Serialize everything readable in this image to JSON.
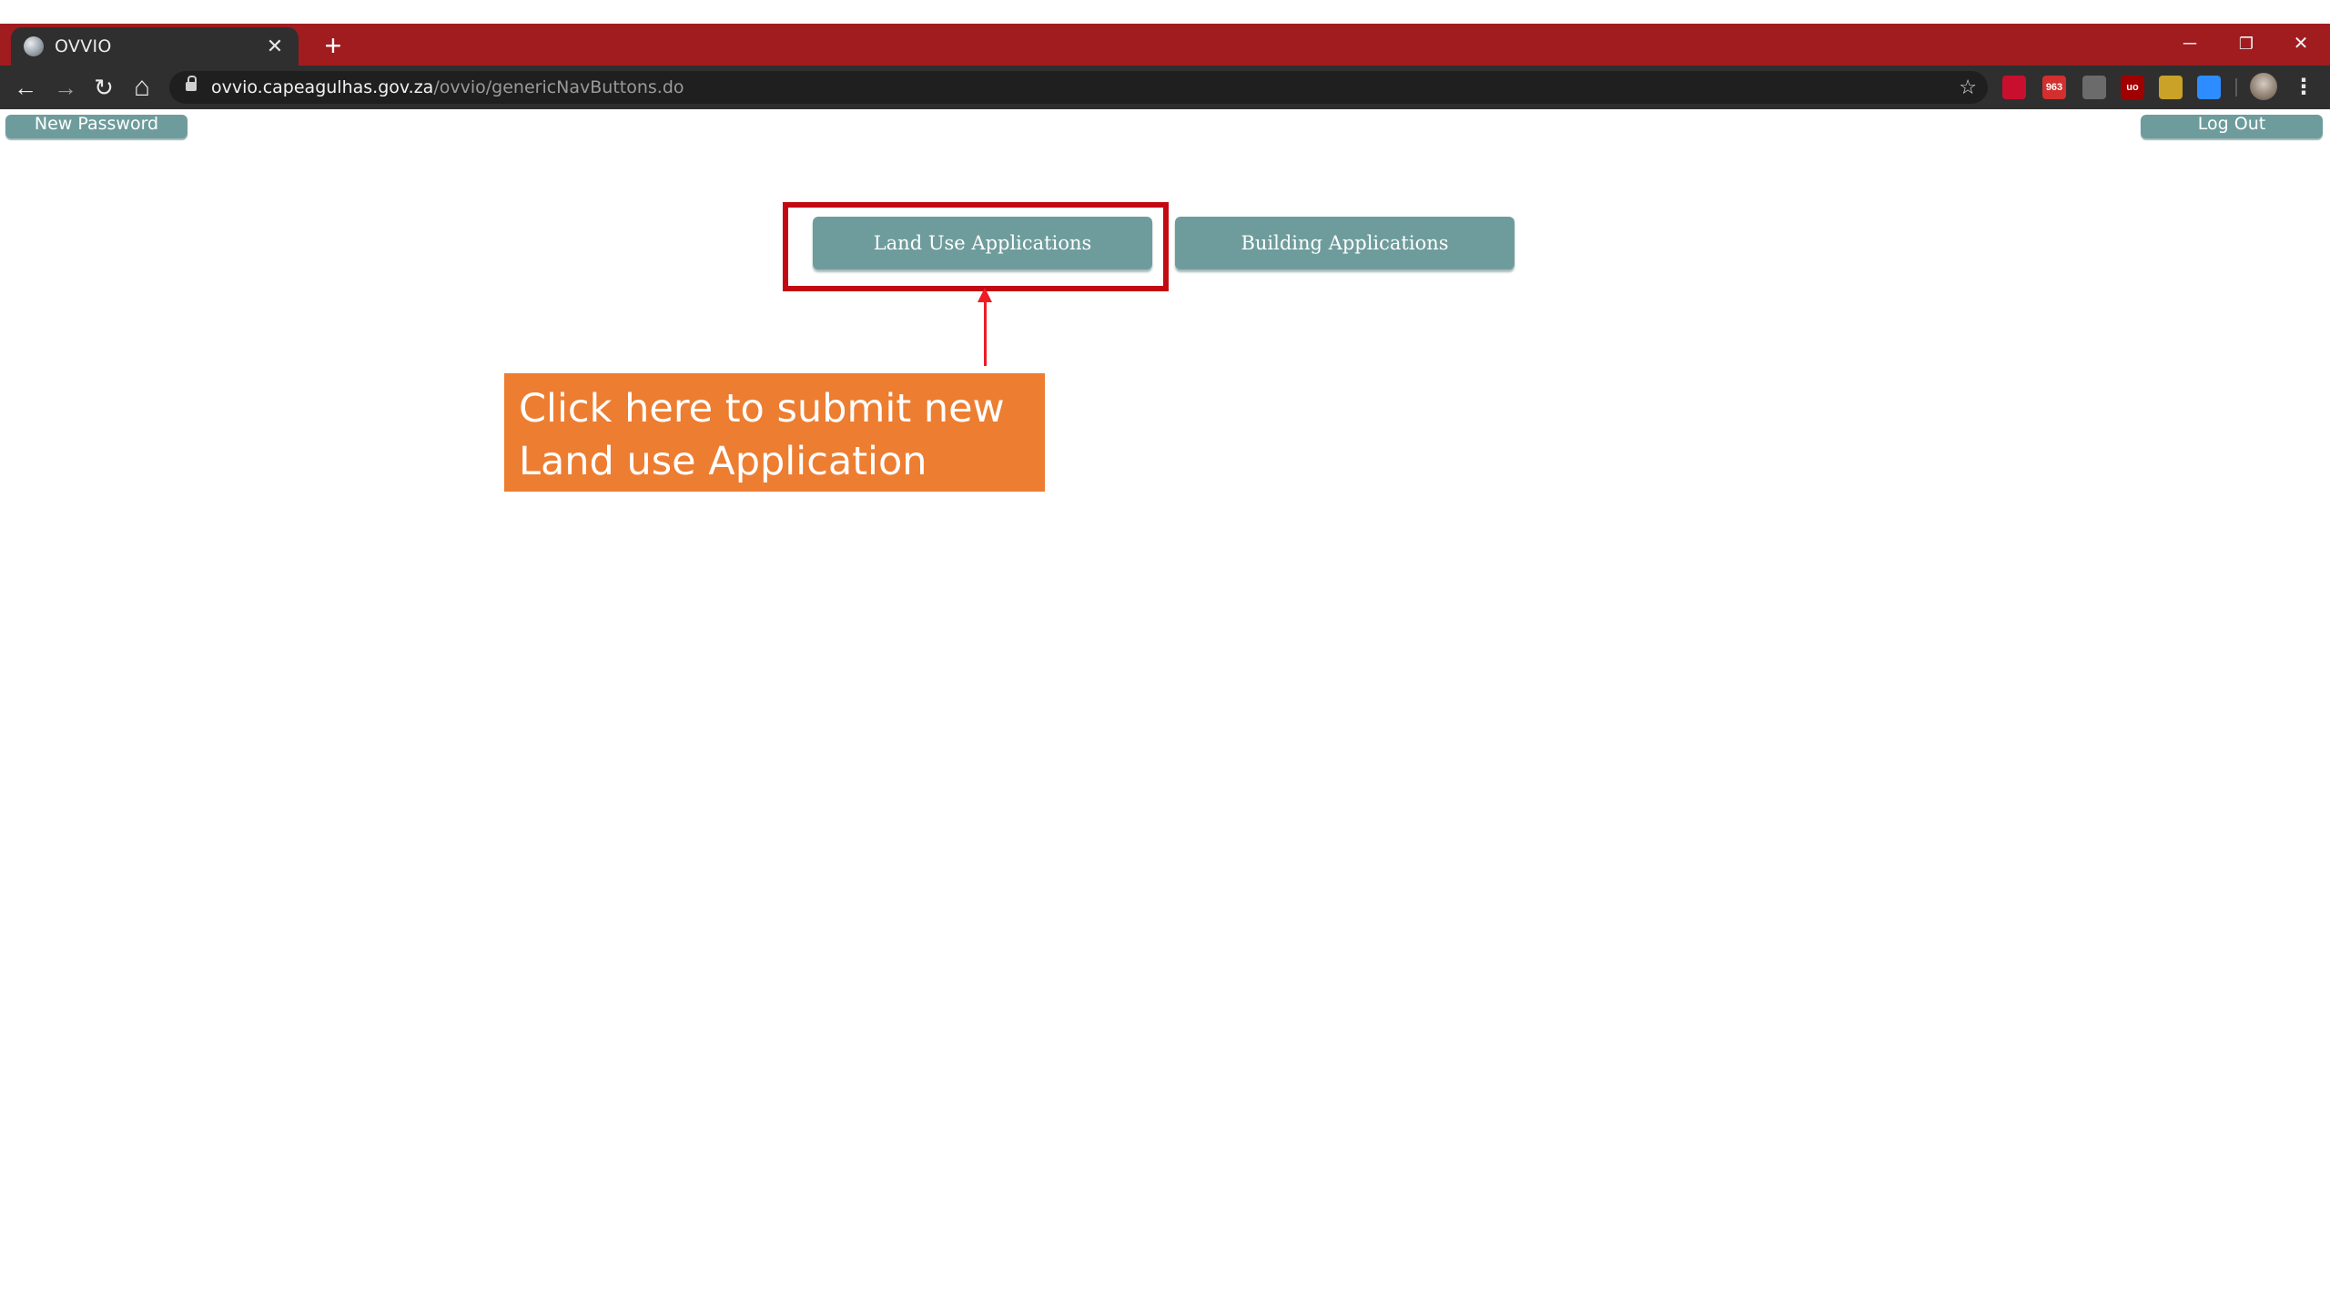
{
  "browser": {
    "tab": {
      "title": "OVVIO",
      "close_glyph": "✕",
      "favicon": "globe-icon"
    },
    "new_tab_glyph": "+",
    "window_controls": {
      "minimize": "─",
      "restore": "❐",
      "close": "✕"
    },
    "nav": {
      "back": "←",
      "forward": "→",
      "reload": "↻",
      "home": "⌂"
    },
    "address": {
      "host": "ovvio.capeagulhas.gov.za",
      "path": "/ovvio/genericNavButtons.do"
    },
    "bookmark_glyph": "☆",
    "extensions": [
      {
        "name": "pdf-extension-icon",
        "label": "",
        "color": "#c8102e"
      },
      {
        "name": "mail-extension-icon",
        "label": "963",
        "color": "#d32f2f"
      },
      {
        "name": "shield-extension-icon",
        "label": "",
        "color": "#6b6b6b"
      },
      {
        "name": "ublock-extension-icon",
        "label": "uo",
        "color": "#a00000"
      },
      {
        "name": "key-extension-icon",
        "label": "",
        "color": "#c9a227"
      },
      {
        "name": "zoom-extension-icon",
        "label": "",
        "color": "#2d8cff"
      }
    ],
    "menu_glyph": "⋮",
    "colors": {
      "title_bar": "#a01c1f",
      "toolbar": "#2f2f2f"
    }
  },
  "page": {
    "new_password_label": "New Password",
    "logout_label": "Log Out",
    "land_use_label": "Land Use Applications",
    "building_label": "Building Applications",
    "button_color": "#6e9c9c"
  },
  "annotation": {
    "callout_line1": "Click here to submit new",
    "callout_line2": "Land use Application",
    "callout_color": "#ed7d31",
    "highlight_color": "#c30a12",
    "arrow_color": "#ee1c24"
  }
}
